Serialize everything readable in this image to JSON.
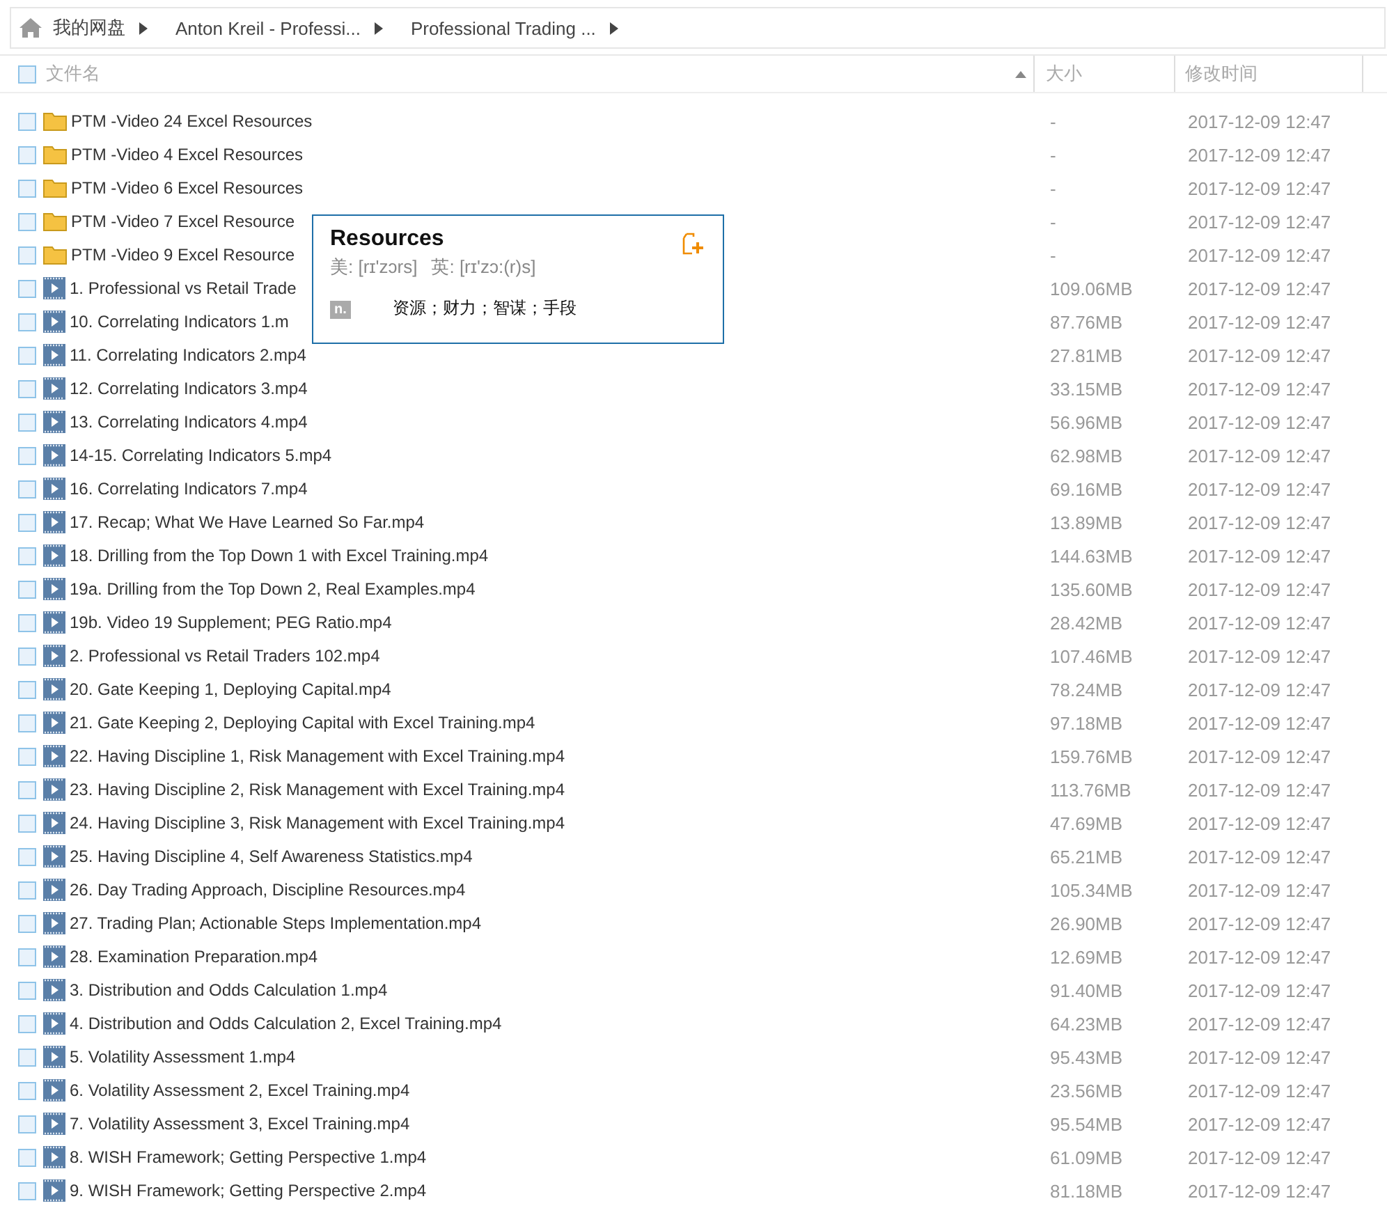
{
  "breadcrumb": [
    {
      "label": "我的网盘",
      "kind": "home"
    },
    {
      "label": "Anton Kreil - Professi..."
    },
    {
      "label": "Professional Trading ..."
    }
  ],
  "header": {
    "checked": false,
    "columns": [
      {
        "label": "文件名",
        "sorted": true
      },
      {
        "label": "大小",
        "sorted": false
      },
      {
        "label": "修改时间",
        "sorted": false
      }
    ]
  },
  "rows": [
    {
      "kind": "folder",
      "name": "PTM -Video 24 Excel Resources",
      "size": "-",
      "date": "2017-12-09 12:47",
      "checked": false
    },
    {
      "kind": "folder",
      "name": "PTM -Video 4 Excel Resources",
      "size": "-",
      "date": "2017-12-09 12:47",
      "checked": false
    },
    {
      "kind": "folder",
      "name": "PTM -Video 6 Excel Resources",
      "size": "-",
      "date": "2017-12-09 12:47",
      "checked": false
    },
    {
      "kind": "folder",
      "name": "PTM -Video 7 Excel Resource",
      "size": "-",
      "date": "2017-12-09 12:47",
      "checked": false
    },
    {
      "kind": "folder",
      "name": "PTM -Video 9 Excel Resource",
      "size": "-",
      "date": "2017-12-09 12:47",
      "checked": false
    },
    {
      "kind": "video",
      "name": "1. Professional vs Retail Trade",
      "size": "109.06MB",
      "date": "2017-12-09 12:47",
      "checked": false
    },
    {
      "kind": "video",
      "name": "10. Correlating Indicators 1.m",
      "size": "87.76MB",
      "date": "2017-12-09 12:47",
      "checked": false
    },
    {
      "kind": "video",
      "name": "11. Correlating Indicators 2.mp4",
      "size": "27.81MB",
      "date": "2017-12-09 12:47",
      "checked": false
    },
    {
      "kind": "video",
      "name": "12. Correlating Indicators 3.mp4",
      "size": "33.15MB",
      "date": "2017-12-09 12:47",
      "checked": false
    },
    {
      "kind": "video",
      "name": "13. Correlating Indicators 4.mp4",
      "size": "56.96MB",
      "date": "2017-12-09 12:47",
      "checked": false
    },
    {
      "kind": "video",
      "name": "14-15. Correlating Indicators 5.mp4",
      "size": "62.98MB",
      "date": "2017-12-09 12:47",
      "checked": false
    },
    {
      "kind": "video",
      "name": "16. Correlating Indicators 7.mp4",
      "size": "69.16MB",
      "date": "2017-12-09 12:47",
      "checked": false
    },
    {
      "kind": "video",
      "name": "17. Recap; What We Have Learned So Far.mp4",
      "size": "13.89MB",
      "date": "2017-12-09 12:47",
      "checked": false
    },
    {
      "kind": "video",
      "name": "18. Drilling from the Top Down 1 with Excel Training.mp4",
      "size": "144.63MB",
      "date": "2017-12-09 12:47",
      "checked": false
    },
    {
      "kind": "video",
      "name": "19a. Drilling from the Top Down 2, Real Examples.mp4",
      "size": "135.60MB",
      "date": "2017-12-09 12:47",
      "checked": false
    },
    {
      "kind": "video",
      "name": "19b. Video 19 Supplement; PEG Ratio.mp4",
      "size": "28.42MB",
      "date": "2017-12-09 12:47",
      "checked": false
    },
    {
      "kind": "video",
      "name": "2. Professional vs Retail Traders 102.mp4",
      "size": "107.46MB",
      "date": "2017-12-09 12:47",
      "checked": false
    },
    {
      "kind": "video",
      "name": "20. Gate Keeping 1, Deploying Capital.mp4",
      "size": "78.24MB",
      "date": "2017-12-09 12:47",
      "checked": false
    },
    {
      "kind": "video",
      "name": "21. Gate Keeping 2, Deploying Capital with Excel Training.mp4",
      "size": "97.18MB",
      "date": "2017-12-09 12:47",
      "checked": false
    },
    {
      "kind": "video",
      "name": "22. Having Discipline 1, Risk Management with Excel Training.mp4",
      "size": "159.76MB",
      "date": "2017-12-09 12:47",
      "checked": false
    },
    {
      "kind": "video",
      "name": "23. Having Discipline 2, Risk Management with Excel Training.mp4",
      "size": "113.76MB",
      "date": "2017-12-09 12:47",
      "checked": false
    },
    {
      "kind": "video",
      "name": "24. Having Discipline 3, Risk Management with Excel Training.mp4",
      "size": "47.69MB",
      "date": "2017-12-09 12:47",
      "checked": false
    },
    {
      "kind": "video",
      "name": "25. Having Discipline 4, Self Awareness Statistics.mp4",
      "size": "65.21MB",
      "date": "2017-12-09 12:47",
      "checked": false
    },
    {
      "kind": "video",
      "name": "26. Day Trading Approach, Discipline Resources.mp4",
      "size": "105.34MB",
      "date": "2017-12-09 12:47",
      "checked": false
    },
    {
      "kind": "video",
      "name": "27. Trading Plan; Actionable Steps Implementation.mp4",
      "size": "26.90MB",
      "date": "2017-12-09 12:47",
      "checked": false
    },
    {
      "kind": "video",
      "name": "28. Examination Preparation.mp4",
      "size": "12.69MB",
      "date": "2017-12-09 12:47",
      "checked": false
    },
    {
      "kind": "video",
      "name": "3. Distribution and Odds Calculation 1.mp4",
      "size": "91.40MB",
      "date": "2017-12-09 12:47",
      "checked": false
    },
    {
      "kind": "video",
      "name": "4. Distribution and Odds Calculation 2, Excel Training.mp4",
      "size": "64.23MB",
      "date": "2017-12-09 12:47",
      "checked": false
    },
    {
      "kind": "video",
      "name": "5. Volatility Assessment 1.mp4",
      "size": "95.43MB",
      "date": "2017-12-09 12:47",
      "checked": false
    },
    {
      "kind": "video",
      "name": "6. Volatility Assessment 2, Excel Training.mp4",
      "size": "23.56MB",
      "date": "2017-12-09 12:47",
      "checked": false
    },
    {
      "kind": "video",
      "name": "7. Volatility Assessment 3, Excel Training.mp4",
      "size": "95.54MB",
      "date": "2017-12-09 12:47",
      "checked": false
    },
    {
      "kind": "video",
      "name": "8. WISH Framework; Getting Perspective 1.mp4",
      "size": "61.09MB",
      "date": "2017-12-09 12:47",
      "checked": false
    },
    {
      "kind": "video",
      "name": "9. WISH Framework; Getting Perspective 2.mp4",
      "size": "81.18MB",
      "date": "2017-12-09 12:47",
      "checked": false
    }
  ],
  "dictionary_popup": {
    "word": "Resources",
    "us_phonetic": "美: [rɪ'zɔrs]",
    "uk_phonetic": "英: [rɪ'zɔ:(r)s]",
    "part_of_speech": "n.",
    "meaning": "资源；财力；智谋；手段"
  }
}
